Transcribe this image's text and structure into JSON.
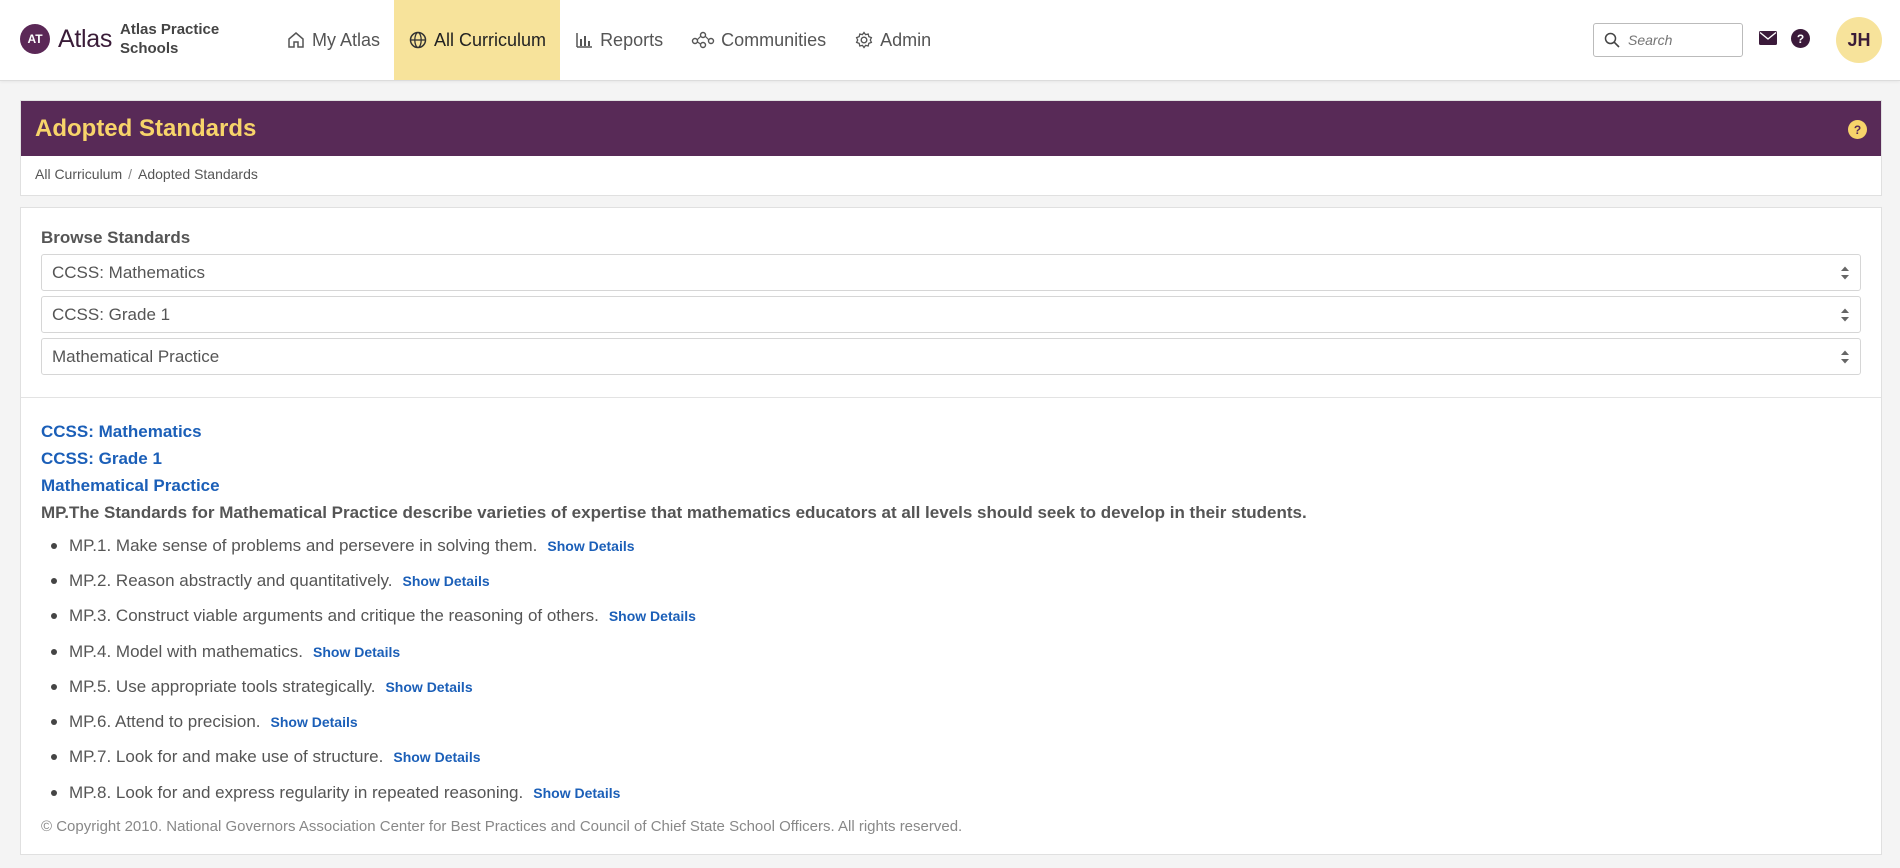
{
  "brand": {
    "mark": "AT",
    "name": "Atlas",
    "school": "Atlas Practice Schools"
  },
  "nav": [
    {
      "label": "My Atlas",
      "icon": "home-icon"
    },
    {
      "label": "All Curriculum",
      "icon": "globe-icon",
      "active": true
    },
    {
      "label": "Reports",
      "icon": "bar-chart-icon"
    },
    {
      "label": "Communities",
      "icon": "network-icon"
    },
    {
      "label": "Admin",
      "icon": "gear-icon"
    }
  ],
  "search": {
    "placeholder": "Search"
  },
  "user": {
    "initials": "JH"
  },
  "page": {
    "title": "Adopted Standards",
    "breadcrumb": [
      "All Curriculum",
      "Adopted Standards"
    ]
  },
  "browse": {
    "label": "Browse Standards",
    "selects": [
      "CCSS: Mathematics",
      "CCSS: Grade 1",
      "Mathematical Practice"
    ]
  },
  "results": {
    "path": [
      "CCSS: Mathematics",
      "CCSS: Grade 1",
      "Mathematical Practice"
    ],
    "heading": "MP.The Standards for Mathematical Practice describe varieties of expertise that mathematics educators at all levels should seek to develop in their students.",
    "details_label": "Show Details",
    "standards": [
      "MP.1. Make sense of problems and persevere in solving them.",
      "MP.2. Reason abstractly and quantitatively.",
      "MP.3. Construct viable arguments and critique the reasoning of others.",
      "MP.4. Model with mathematics.",
      "MP.5. Use appropriate tools strategically.",
      "MP.6. Attend to precision.",
      "MP.7. Look for and make use of structure.",
      "MP.8. Look for and express regularity in repeated reasoning."
    ],
    "copyright": "© Copyright 2010. National Governors Association Center for Best Practices and Council of Chief State School Officers. All rights reserved."
  },
  "colors": {
    "brand_purple": "#582a57",
    "accent_yellow": "#f7e39b",
    "title_yellow": "#f7d46a",
    "link_blue": "#1b5fb8"
  }
}
